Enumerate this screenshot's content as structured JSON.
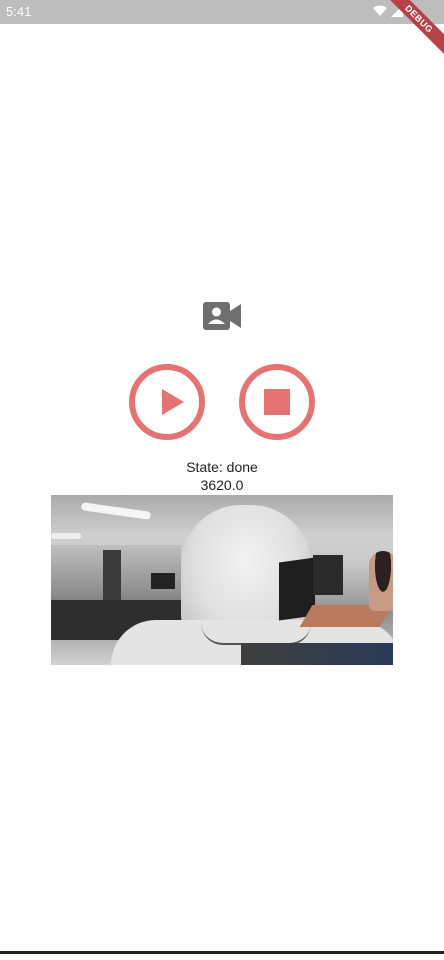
{
  "status_bar": {
    "time": "5:41",
    "icons": [
      "wifi-icon",
      "signal-icon",
      "battery-icon"
    ]
  },
  "debug_banner": "DEBUG",
  "media_icon": "videocam-icon",
  "controls": {
    "play_icon": "play-icon",
    "stop_icon": "stop-icon",
    "accent_color": "#e57373"
  },
  "state_label": "State: done",
  "value_label": "3620.0",
  "preview": {
    "content": "360 panorama video frame"
  }
}
